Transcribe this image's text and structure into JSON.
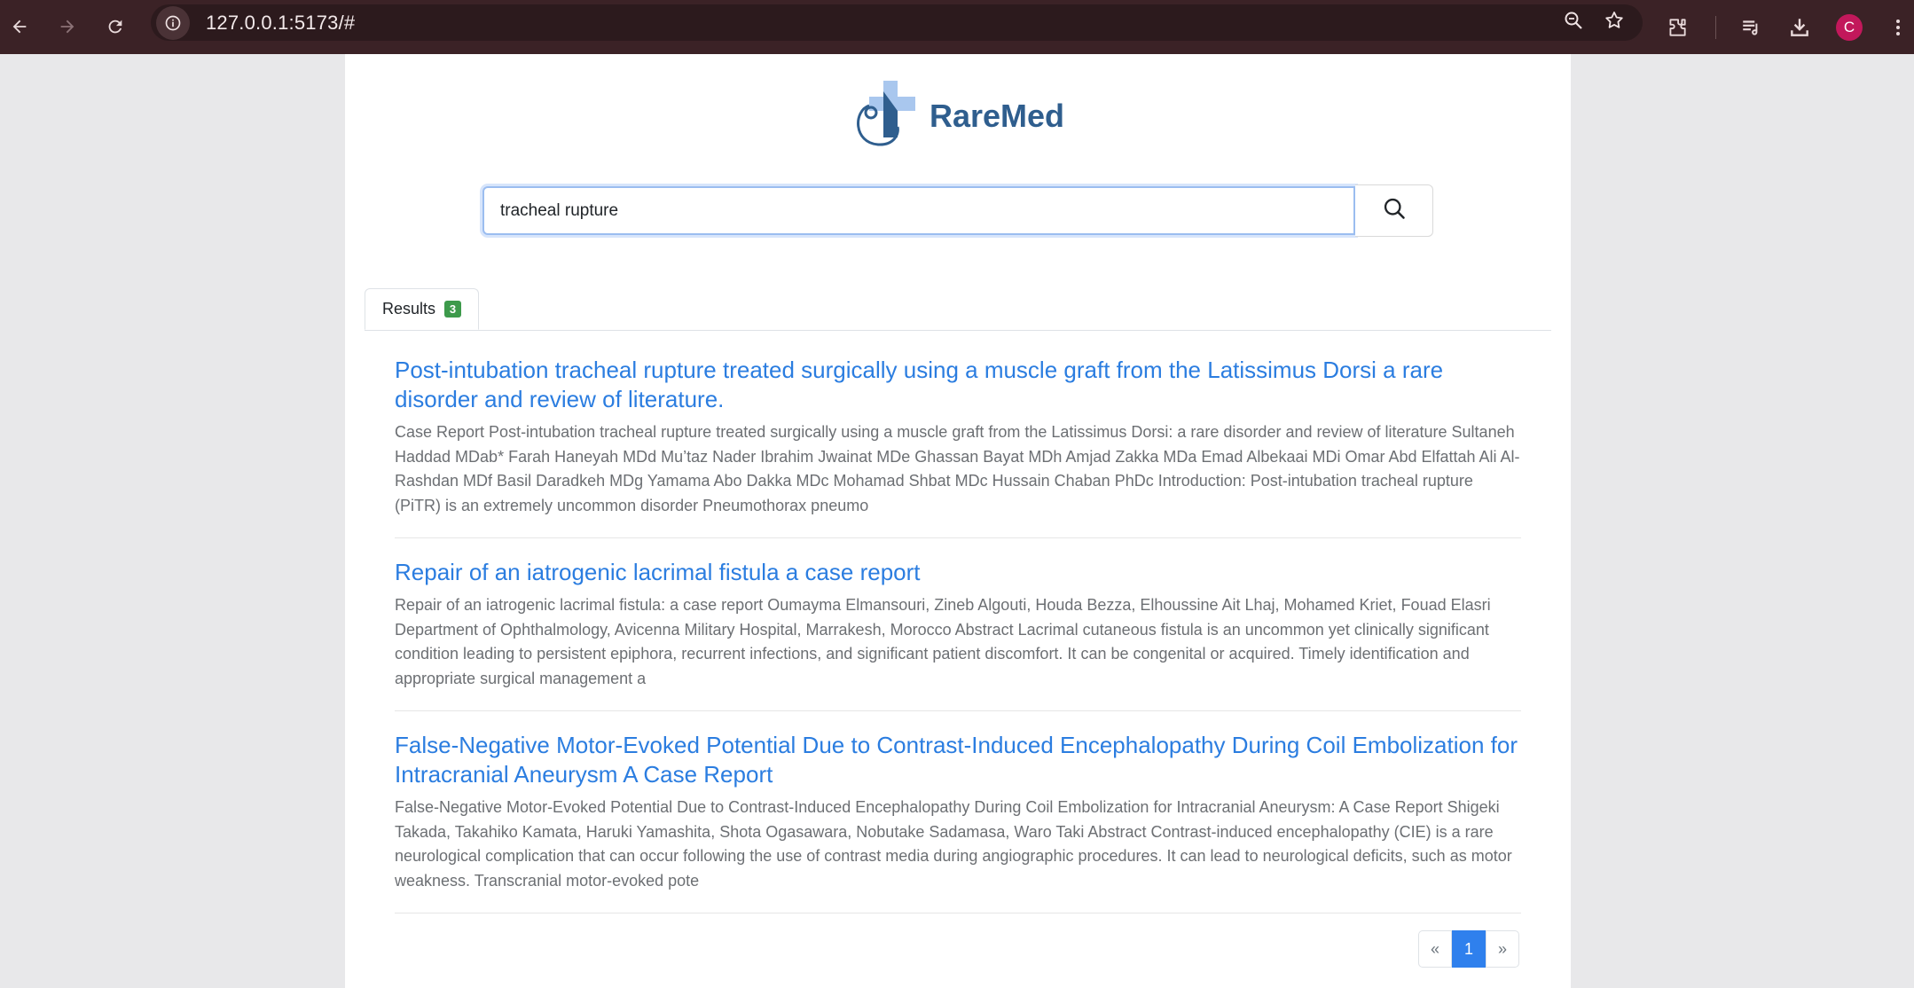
{
  "browser": {
    "url": "127.0.0.1:5173/#",
    "profile_initial": "C",
    "icons": [
      "back-icon",
      "forward-icon",
      "reload-icon",
      "site-info-icon",
      "zoom-icon",
      "bookmark-star-icon",
      "extensions-icon",
      "media-control-icon",
      "download-icon",
      "kebab-menu-icon"
    ]
  },
  "app": {
    "brand": "RareMed"
  },
  "search": {
    "value": "tracheal rupture"
  },
  "tabs": {
    "results_label": "Results",
    "results_count": "3"
  },
  "results": [
    {
      "title": "Post-intubation tracheal rupture treated surgically using a muscle graft from the Latissimus Dorsi a rare disorder and review of literature.",
      "snippet": "Case Report Post-intubation tracheal rupture treated surgically using a muscle graft from the Latissimus Dorsi: a rare disorder and review of literature Sultaneh Haddad MDab* Farah Haneyah MDd Mu’taz Nader Ibrahim Jwainat MDe Ghassan Bayat MDh Amjad Zakka MDa Emad Albekaai MDi Omar Abd Elfattah Ali Al-Rashdan MDf Basil Daradkeh MDg Yamama Abo Dakka MDc Mohamad Shbat MDc Hussain Chaban PhDc Introduction: Post-intubation tracheal rupture (PiTR) is an extremely uncommon disorder Pneumothorax pneumo"
    },
    {
      "title": "Repair of an iatrogenic lacrimal fistula a case report",
      "snippet": "Repair of an iatrogenic lacrimal fistula: a case report Oumayma Elmansouri, Zineb Algouti, Houda Bezza, Elhoussine Ait Lhaj, Mohamed Kriet, Fouad Elasri Department of Ophthalmology, Avicenna Military Hospital, Marrakesh, Morocco Abstract Lacrimal cutaneous fistula is an uncommon yet clinically significant condition leading to persistent epiphora, recurrent infections, and significant patient discomfort. It can be congenital or acquired. Timely identification and appropriate surgical management a"
    },
    {
      "title": "False-Negative Motor-Evoked Potential Due to Contrast-Induced Encephalopathy During Coil Embolization for Intracranial Aneurysm A Case Report",
      "snippet": "False-Negative Motor-Evoked Potential Due to Contrast-Induced Encephalopathy During Coil Embolization for Intracranial Aneurysm: A Case Report Shigeki Takada, Takahiko Kamata, Haruki Yamashita, Shota Ogasawara, Nobutake Sadamasa, Waro Taki Abstract Contrast-induced encephalopathy (CIE) is a rare neurological complication that can occur following the use of contrast media during angiographic procedures. It can lead to neurological deficits, such as motor weakness. Transcranial motor-evoked pote"
    }
  ],
  "pagination": {
    "prev": "«",
    "current": "1",
    "next": "»"
  }
}
